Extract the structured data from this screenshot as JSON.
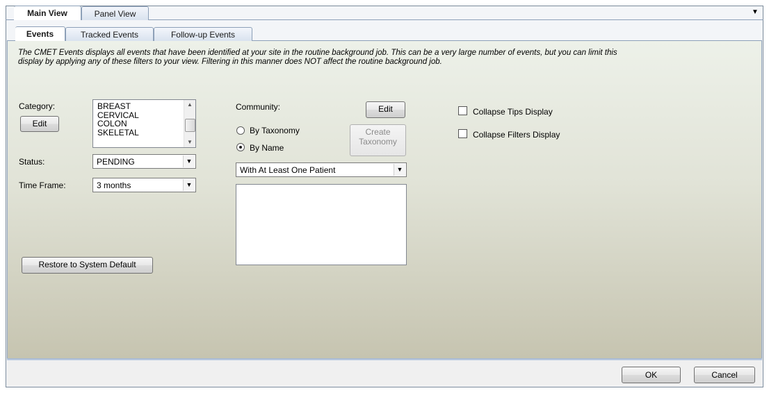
{
  "main_tabs": [
    {
      "label": "Main View",
      "active": true
    },
    {
      "label": "Panel View",
      "active": false
    }
  ],
  "sub_tabs": [
    {
      "label": "Events",
      "active": true
    },
    {
      "label": "Tracked Events",
      "active": false
    },
    {
      "label": "Follow-up Events",
      "active": false
    }
  ],
  "description": "The CMET Events displays all events that have been identified at your site in the routine background job.  This can be a very large number of events, but you can limit this display by applying any of these filters to your view.  Filtering in this manner does NOT affect the routine background job.",
  "category": {
    "label": "Category:",
    "edit_label": "Edit",
    "items": [
      "BREAST",
      "CERVICAL",
      "COLON",
      "SKELETAL"
    ]
  },
  "status": {
    "label": "Status:",
    "value": "PENDING"
  },
  "time_frame": {
    "label": "Time Frame:",
    "value": "3 months"
  },
  "restore_label": "Restore to System Default",
  "community": {
    "label": "Community:",
    "edit_label": "Edit",
    "by_taxonomy_label": "By Taxonomy",
    "by_name_label": "By Name",
    "selected_mode": "By Name",
    "create_taxonomy_line1": "Create",
    "create_taxonomy_line2": "Taxonomy",
    "filter_value": "With At Least One Patient"
  },
  "options": {
    "collapse_tips_label": "Collapse Tips Display",
    "collapse_filters_label": "Collapse Filters Display"
  },
  "buttons": {
    "ok": "OK",
    "cancel": "Cancel"
  },
  "icons": {
    "dropdown": "triangle-down",
    "scroll_up": "triangle-up",
    "scroll_down": "triangle-down"
  }
}
